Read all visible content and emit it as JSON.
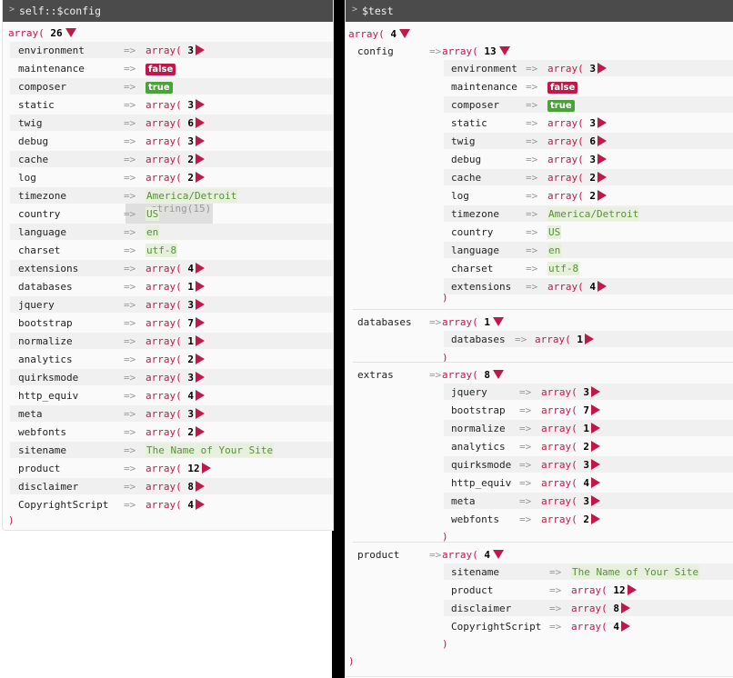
{
  "left": {
    "header": "self::$config",
    "count": "26",
    "rows": [
      {
        "key": "environment",
        "type": "array",
        "count": "3"
      },
      {
        "key": "maintenance",
        "type": "false",
        "label": "false"
      },
      {
        "key": "composer",
        "type": "true",
        "label": "true"
      },
      {
        "key": "static",
        "type": "array",
        "count": "3"
      },
      {
        "key": "twig",
        "type": "array",
        "count": "6"
      },
      {
        "key": "debug",
        "type": "array",
        "count": "3"
      },
      {
        "key": "cache",
        "type": "array",
        "count": "2"
      },
      {
        "key": "log",
        "type": "array",
        "count": "2"
      },
      {
        "key": "timezone",
        "type": "string",
        "value": "America/Detroit"
      },
      {
        "key": "country",
        "type": "string",
        "value": "US"
      },
      {
        "key": "language",
        "type": "string",
        "value": "en"
      },
      {
        "key": "charset",
        "type": "string",
        "value": "utf-8"
      },
      {
        "key": "extensions",
        "type": "array",
        "count": "4"
      },
      {
        "key": "databases",
        "type": "array",
        "count": "1"
      },
      {
        "key": "jquery",
        "type": "array",
        "count": "3"
      },
      {
        "key": "bootstrap",
        "type": "array",
        "count": "7"
      },
      {
        "key": "normalize",
        "type": "array",
        "count": "1"
      },
      {
        "key": "analytics",
        "type": "array",
        "count": "2"
      },
      {
        "key": "quirksmode",
        "type": "array",
        "count": "3"
      },
      {
        "key": "http_equiv",
        "type": "array",
        "count": "4"
      },
      {
        "key": "meta",
        "type": "array",
        "count": "3"
      },
      {
        "key": "webfonts",
        "type": "array",
        "count": "2"
      },
      {
        "key": "sitename",
        "type": "string",
        "value": "The Name of Your Site"
      },
      {
        "key": "product",
        "type": "array",
        "count": "12"
      },
      {
        "key": "disclaimer",
        "type": "array",
        "count": "8"
      },
      {
        "key": "CopyrightScript",
        "type": "array",
        "count": "4"
      }
    ],
    "tooltip": "string(15)"
  },
  "right": {
    "header": "$test",
    "count": "4",
    "groups": [
      {
        "key": "config",
        "count": "13",
        "rows": [
          {
            "key": "environment",
            "type": "array",
            "count": "3"
          },
          {
            "key": "maintenance",
            "type": "false",
            "label": "false"
          },
          {
            "key": "composer",
            "type": "true",
            "label": "true"
          },
          {
            "key": "static",
            "type": "array",
            "count": "3"
          },
          {
            "key": "twig",
            "type": "array",
            "count": "6"
          },
          {
            "key": "debug",
            "type": "array",
            "count": "3"
          },
          {
            "key": "cache",
            "type": "array",
            "count": "2"
          },
          {
            "key": "log",
            "type": "array",
            "count": "2"
          },
          {
            "key": "timezone",
            "type": "string",
            "value": "America/Detroit"
          },
          {
            "key": "country",
            "type": "string",
            "value": "US"
          },
          {
            "key": "language",
            "type": "string",
            "value": "en"
          },
          {
            "key": "charset",
            "type": "string",
            "value": "utf-8"
          },
          {
            "key": "extensions",
            "type": "array",
            "count": "4"
          }
        ]
      },
      {
        "key": "databases",
        "count": "1",
        "rows": [
          {
            "key": "databases",
            "type": "array",
            "count": "1"
          }
        ]
      },
      {
        "key": "extras",
        "count": "8",
        "rows": [
          {
            "key": "jquery",
            "type": "array",
            "count": "3"
          },
          {
            "key": "bootstrap",
            "type": "array",
            "count": "7"
          },
          {
            "key": "normalize",
            "type": "array",
            "count": "1"
          },
          {
            "key": "analytics",
            "type": "array",
            "count": "2"
          },
          {
            "key": "quirksmode",
            "type": "array",
            "count": "3"
          },
          {
            "key": "http_equiv",
            "type": "array",
            "count": "4"
          },
          {
            "key": "meta",
            "type": "array",
            "count": "3"
          },
          {
            "key": "webfonts",
            "type": "array",
            "count": "2"
          }
        ]
      },
      {
        "key": "product",
        "count": "4",
        "rows": [
          {
            "key": "sitename",
            "type": "string",
            "value": "The Name of Your Site"
          },
          {
            "key": "product",
            "type": "array",
            "count": "12"
          },
          {
            "key": "disclaimer",
            "type": "array",
            "count": "8"
          },
          {
            "key": "CopyrightScript",
            "type": "array",
            "count": "4"
          }
        ]
      }
    ]
  },
  "labels": {
    "array": "array(",
    "close": ")",
    "arrow": "=>"
  },
  "colors": {
    "accent": "#c0184a",
    "true_badge": "#4aa336",
    "string_bg": "#e6f0dc",
    "string_fg": "#5a8f3a",
    "header_bg": "#4b4b4b"
  }
}
